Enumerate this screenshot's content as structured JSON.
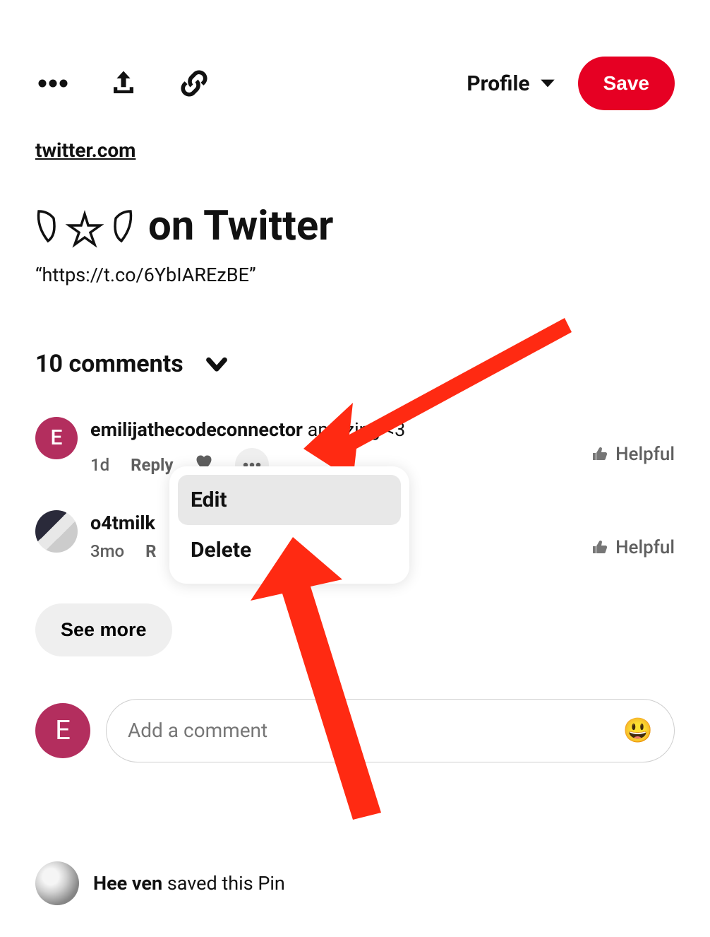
{
  "header": {
    "board_label": "Profile",
    "save_label": "Save"
  },
  "pin": {
    "source_domain": "twitter.com",
    "title": "on Twitter",
    "subtitle": "“https://t.co/6YbIAREzBE”"
  },
  "comments": {
    "count_label": "10 comments",
    "items": [
      {
        "user": "emilijathecodeconnector",
        "text": " amazing <3",
        "time": "1d",
        "reply_label": "Reply",
        "helpful_label": "Helpful"
      },
      {
        "user": "o4tmilk",
        "text": "",
        "time": "3mo",
        "reply_label": "R",
        "helpful_label": "Helpful"
      }
    ],
    "see_more_label": "See more"
  },
  "dropdown": {
    "edit_label": "Edit",
    "delete_label": "Delete"
  },
  "input": {
    "avatar_initial": "E",
    "placeholder": "Add a comment",
    "emoji": "😃"
  },
  "saved": {
    "user": "Hee ven",
    "suffix": " saved this Pin"
  },
  "avatar_initial": "E"
}
